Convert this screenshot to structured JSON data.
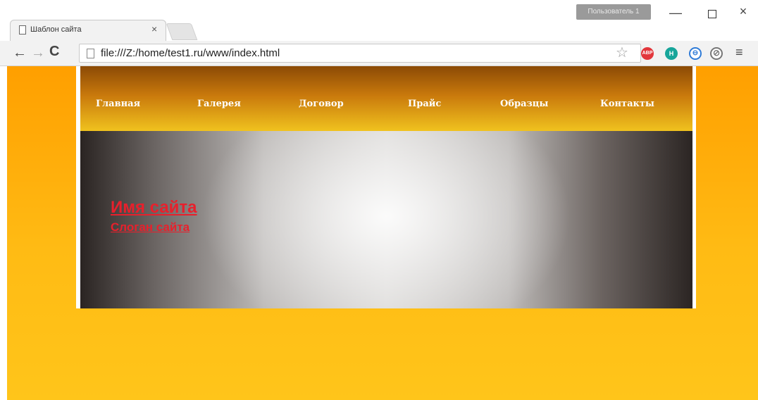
{
  "browser": {
    "tab_title": "Шаблон сайта",
    "tab_close": "×",
    "user_badge": "Пользователь 1",
    "window_controls": {
      "minimize": "—",
      "close": "×"
    },
    "nav": {
      "back": "←",
      "forward": "→",
      "reload": "C"
    },
    "address": "file:///Z:/home/test1.ru/www/index.html",
    "bookmark_star": "☆",
    "extensions": [
      {
        "name": "adblock-plus",
        "label": "ABP",
        "color": "#e2363b"
      },
      {
        "name": "h-extension",
        "label": "H",
        "color": "#17a59a"
      },
      {
        "name": "sync-extension",
        "label": "⊖",
        "color": "#2f7bd7"
      },
      {
        "name": "block-extension",
        "label": "⊘",
        "color": "#777777"
      }
    ],
    "menu": "≡"
  },
  "site": {
    "nav_items": [
      "Главная",
      "Галерея",
      "Договор",
      "Прайс",
      "Образцы",
      "Контакты"
    ],
    "name": "Имя сайта",
    "slogan": "Слоган сайта",
    "colors": {
      "accent_text": "#e8202c",
      "page_background": "#ffa500",
      "nav_gradient_top": "#8b4a06",
      "nav_gradient_bottom": "#f0c21e"
    }
  }
}
